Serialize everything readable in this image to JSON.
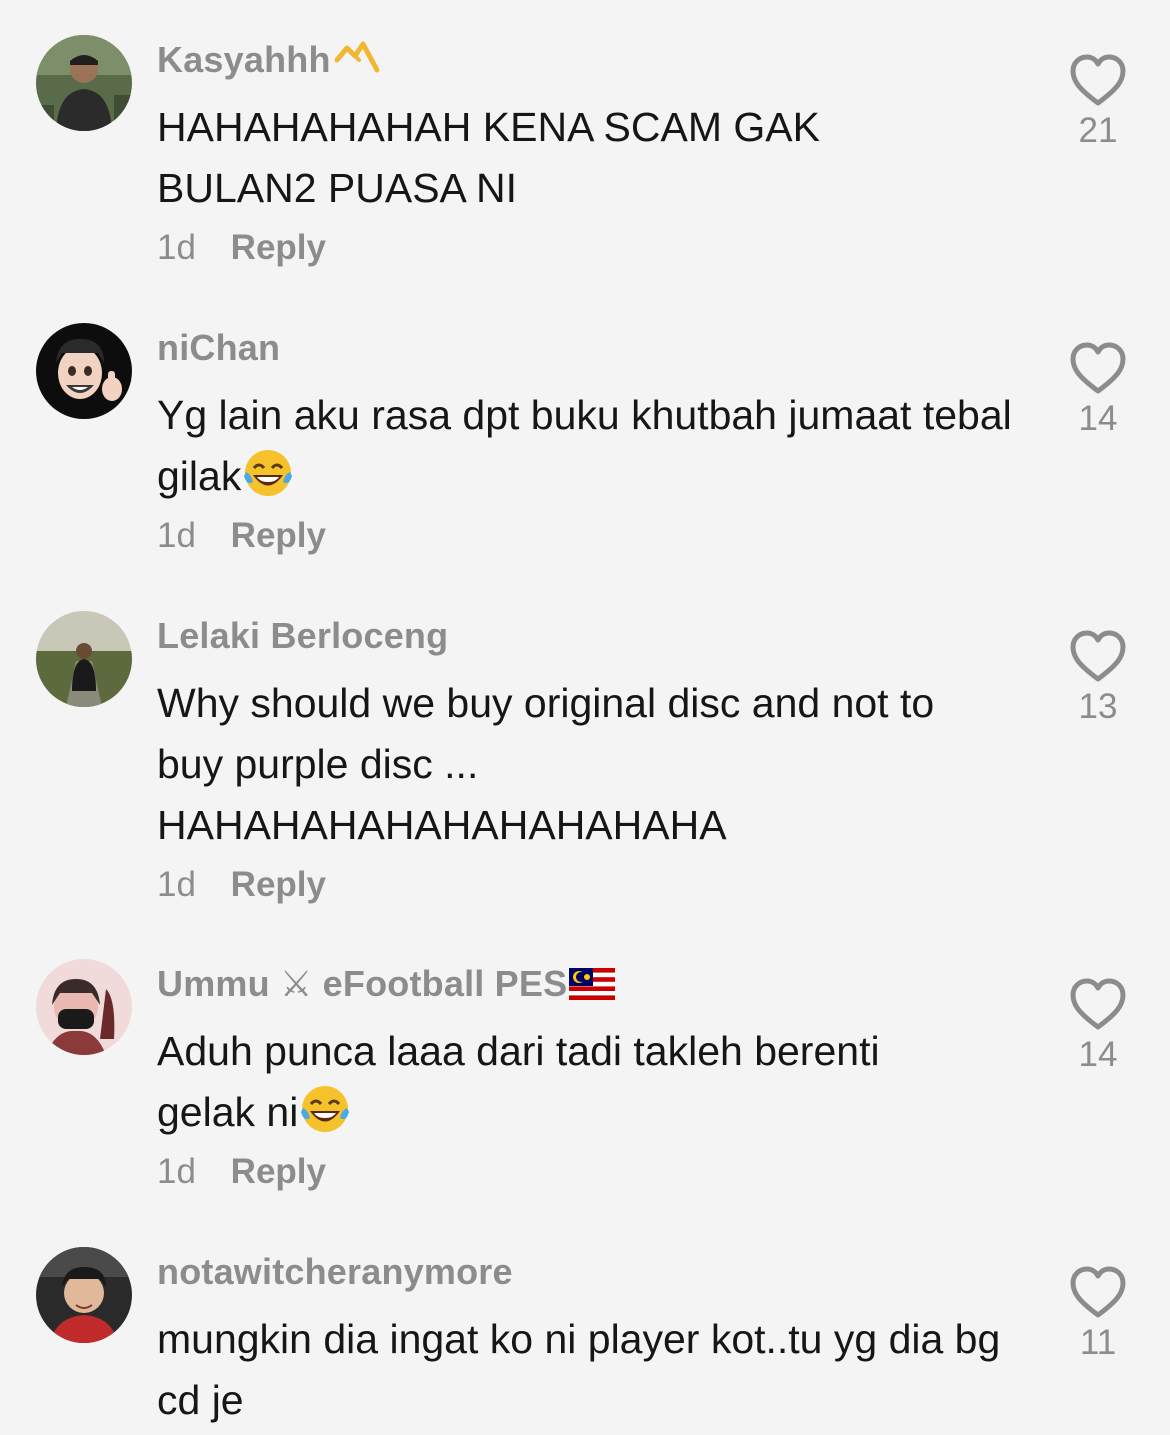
{
  "comments": [
    {
      "username": "Kasyahhh",
      "badge_icon": "crown-scribble-icon",
      "text": "HAHAHAHAHAH KENA SCAM GAK BULAN2 PUASA NI",
      "emoji": "",
      "time": "1d",
      "reply_label": "Reply",
      "likes": "21"
    },
    {
      "username": "niChan",
      "text": "Yg lain aku rasa dpt buku khutbah jumaat tebal gilak",
      "emoji": "face-with-tears-of-joy-emoji",
      "time": "1d",
      "reply_label": "Reply",
      "likes": "14"
    },
    {
      "username": "Lelaki Berloceng",
      "text_lines": [
        "Why should we buy original disc and not to",
        "buy purple disc ...",
        "HAHAHAHAHAHAHAHAHAHA"
      ],
      "time": "1d",
      "reply_label": "Reply",
      "likes": "13"
    },
    {
      "username": "Ummu ⚔ eFootball PES",
      "flag_icon": "malaysia-flag-icon",
      "text": "Aduh punca laaa dari tadi takleh berenti gelak ni",
      "emoji": "face-with-tears-of-joy-emoji",
      "time": "1d",
      "reply_label": "Reply",
      "likes": "14"
    },
    {
      "username": "notawitcheranymore",
      "text": "mungkin dia ingat ko ni player kot..tu yg dia bg cd je",
      "time": "",
      "reply_label": "",
      "likes": "11"
    }
  ],
  "colors": {
    "background": "#f4f4f4",
    "username": "#8c8c8c",
    "text": "#161616",
    "meta": "#8c8c8c",
    "heart_outline": "#8c8c8c",
    "badge": "#f2b632"
  }
}
